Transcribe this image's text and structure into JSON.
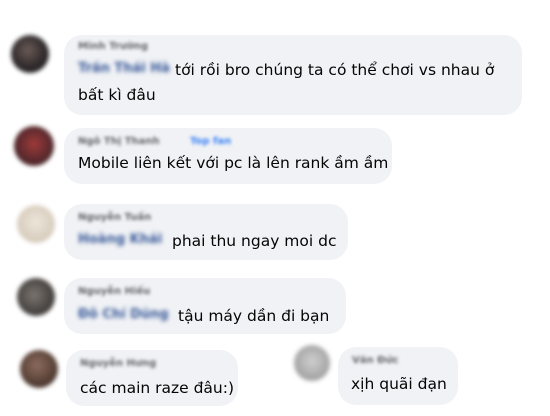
{
  "colors": {
    "bubble": "#f0f2f5",
    "text": "#050505",
    "author": "#65676b",
    "tag": "#385898"
  },
  "comments": [
    {
      "author": "Minh Trường",
      "tagged": "Trần Thái Hà",
      "text_line1": "tới rồi bro chúng ta có thể chơi vs nhau ở",
      "text_line2": "bất kì đâu"
    },
    {
      "author": "Ngô Thị Thanh",
      "badge": "Top fan",
      "text": "Mobile liên kết với pc là lên rank ầm ầm"
    },
    {
      "author": "Nguyễn Tuấn",
      "tagged": "Hoàng Khải",
      "text": "phai thu ngay moi dc"
    },
    {
      "author": "Nguyễn Hiếu",
      "tagged": "Đỗ Chí Dũng",
      "text": "tậu máy dần đi bạn"
    },
    {
      "author": "Nguyễn Hưng",
      "text": "các main raze đâu:)"
    },
    {
      "author": "Văn Đức",
      "text": "xịh quãi đạn"
    }
  ]
}
